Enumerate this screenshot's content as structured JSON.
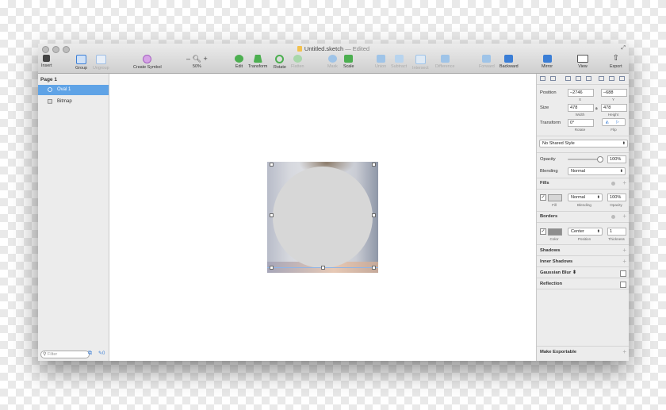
{
  "window": {
    "title": "Untitled.sketch",
    "status": "— Edited"
  },
  "toolbar": {
    "insert": "Insert",
    "group": "Group",
    "ungroup": "Ungroup",
    "create_symbol": "Create Symbol",
    "zoom_out": "–",
    "zoom_in": "+",
    "zoom": "50%",
    "edit": "Edit",
    "transform": "Transform",
    "rotate": "Rotate",
    "flatten": "Flatten",
    "mask": "Mask",
    "scale": "Scale",
    "union": "Union",
    "subtract": "Subtract",
    "intersect": "Intersect",
    "difference": "Difference",
    "forward": "Forward",
    "backward": "Backward",
    "mirror": "Mirror",
    "view": "View",
    "export": "Export"
  },
  "layers": {
    "page": "Page 1",
    "items": [
      {
        "name": "Oval 1",
        "selected": true
      },
      {
        "name": "Bitmap",
        "selected": false
      }
    ],
    "filter_placeholder": "Filter",
    "slice_count": "0"
  },
  "inspector": {
    "position_label": "Position",
    "x": "–2746",
    "x_label": "X",
    "y": "–688",
    "y_label": "Y",
    "size_label": "Size",
    "width": "478",
    "width_label": "Width",
    "height": "478",
    "height_label": "Height",
    "transform_label": "Transform",
    "rotate": "0°",
    "rotate_label": "Rotate",
    "flip_label": "Flip",
    "shared_style": "No Shared Style",
    "opacity_label": "Opacity",
    "opacity": "100%",
    "opacity_fraction": 1.0,
    "blending_label": "Blending",
    "blending": "Normal",
    "fills_label": "Fills",
    "fill_label": "Fill",
    "fill_blending": "Normal",
    "fill_blending_label": "Blending",
    "fill_opacity": "100%",
    "fill_opacity_label": "Opacity",
    "borders_label": "Borders",
    "border_color_label": "Color",
    "border_position": "Center",
    "border_position_label": "Position",
    "border_thickness": "1",
    "border_thickness_label": "Thickness",
    "shadows_label": "Shadows",
    "inner_shadows_label": "Inner Shadows",
    "gaussian_blur_label": "Gaussian Blur",
    "reflection_label": "Reflection",
    "make_exportable_label": "Make Exportable"
  },
  "colors": {
    "selection": "#5fa3e6",
    "oval_fill": "#d7d7d7",
    "accent": "#3b7ed6"
  }
}
